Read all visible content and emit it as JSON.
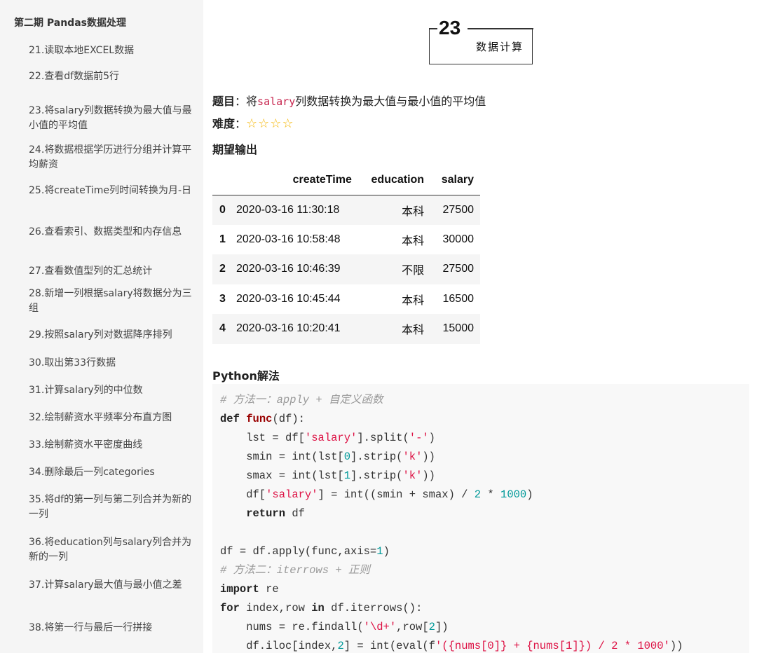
{
  "sidebar": {
    "title": "第二期 Pandas数据处理",
    "items": [
      "21.读取本地EXCEL数据",
      "22.查看df数据前5行",
      "23.将salary列数据转换为最大值与最小值的平均值",
      "24.将数据根据学历进行分组并计算平均薪资",
      "25.将createTime列时间转换为月-日",
      "26.查看索引、数据类型和内存信息",
      "27.查看数值型列的汇总统计",
      "28.新增一列根据salary将数据分为三组",
      "29.按照salary列对数据降序排列",
      "30.取出第33行数据",
      "31.计算salary列的中位数",
      "32.绘制薪资水平频率分布直方图",
      "33.绘制薪资水平密度曲线",
      "34.删除最后一列categories",
      "35.将df的第一列与第二列合并为新的一列",
      "36.将education列与salary列合并为新的一列",
      "37.计算salary最大值与最小值之差",
      "38.将第一行与最后一行拼接"
    ]
  },
  "header": {
    "number": "23",
    "subtitle": "数据计算"
  },
  "question": {
    "label": "题目",
    "sep": "：",
    "prefix": "将",
    "code": "salary",
    "suffix": "列数据转换为最大值与最小值的平均值"
  },
  "difficulty": {
    "label": "难度",
    "sep": "：",
    "stars": "☆☆☆☆",
    "rating": 4
  },
  "expected_label": "期望输出",
  "table": {
    "columns": [
      "",
      "createTime",
      "education",
      "salary"
    ],
    "rows": [
      [
        "0",
        "2020-03-16 11:30:18",
        "本科",
        "27500"
      ],
      [
        "1",
        "2020-03-16 10:58:48",
        "本科",
        "30000"
      ],
      [
        "2",
        "2020-03-16 10:46:39",
        "不限",
        "27500"
      ],
      [
        "3",
        "2020-03-16 10:45:44",
        "本科",
        "16500"
      ],
      [
        "4",
        "2020-03-16 10:20:41",
        "本科",
        "15000"
      ]
    ]
  },
  "solution_label": "Python解法",
  "code": {
    "lines": [
      [
        [
          "cm",
          "# 方法一：apply + 自定义函数"
        ]
      ],
      [
        [
          "kw",
          "def "
        ],
        [
          "fn",
          "func"
        ],
        [
          "",
          "(df):"
        ]
      ],
      [
        [
          "",
          "    lst = df["
        ],
        [
          "st",
          "'salary'"
        ],
        [
          "",
          "].split("
        ],
        [
          "st",
          "'-'"
        ],
        [
          "",
          ")"
        ]
      ],
      [
        [
          "",
          "    smin = int(lst["
        ],
        [
          "nm",
          "0"
        ],
        [
          "",
          "].strip("
        ],
        [
          "st",
          "'k'"
        ],
        [
          "",
          "))"
        ]
      ],
      [
        [
          "",
          "    smax = int(lst["
        ],
        [
          "nm",
          "1"
        ],
        [
          "",
          "].strip("
        ],
        [
          "st",
          "'k'"
        ],
        [
          "",
          "))"
        ]
      ],
      [
        [
          "",
          "    df["
        ],
        [
          "st",
          "'salary'"
        ],
        [
          "",
          "] = int((smin + smax) / "
        ],
        [
          "nm",
          "2"
        ],
        [
          "",
          " * "
        ],
        [
          "nm",
          "1000"
        ],
        [
          "",
          ")"
        ]
      ],
      [
        [
          "kw",
          "    return"
        ],
        [
          "",
          " df"
        ]
      ],
      [
        [
          "",
          ""
        ]
      ],
      [
        [
          "",
          "df = df.apply(func,axis="
        ],
        [
          "nm",
          "1"
        ],
        [
          "",
          ")"
        ]
      ],
      [
        [
          "cm",
          "# 方法二：iterrows + 正则"
        ]
      ],
      [
        [
          "kw",
          "import"
        ],
        [
          "",
          " re"
        ]
      ],
      [
        [
          "kw",
          "for"
        ],
        [
          "",
          " index,row "
        ],
        [
          "kw",
          "in"
        ],
        [
          "",
          " df.iterrows():"
        ]
      ],
      [
        [
          "",
          "    nums = re.findall("
        ],
        [
          "st",
          "'\\d+'"
        ],
        [
          "",
          ",row["
        ],
        [
          "nm",
          "2"
        ],
        [
          "",
          "])"
        ]
      ],
      [
        [
          "",
          "    df.iloc[index,"
        ],
        [
          "nm",
          "2"
        ],
        [
          "",
          "] = int(eval(f"
        ],
        [
          "st",
          "'({nums[0]} + {nums[1]}) / 2 * 1000'"
        ],
        [
          "",
          "))"
        ]
      ]
    ]
  }
}
